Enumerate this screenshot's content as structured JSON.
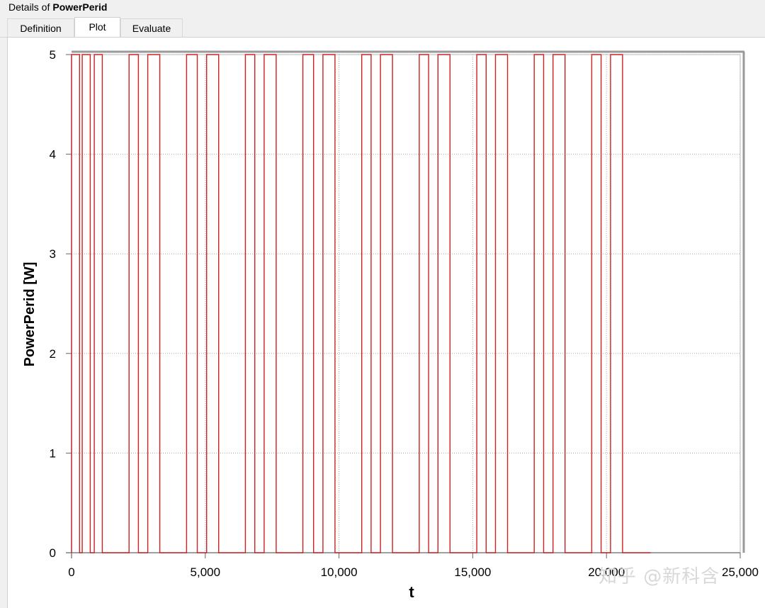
{
  "window": {
    "title_prefix": "Details of",
    "title_name": "PowerPerid"
  },
  "tabs": [
    {
      "label": "Definition",
      "active": false
    },
    {
      "label": "Plot",
      "active": true
    },
    {
      "label": "Evaluate",
      "active": false
    }
  ],
  "watermark": "知乎 @新科含",
  "colors": {
    "series": "#cc2222",
    "axis": "#555555",
    "grid": "#a8a8a8"
  },
  "chart_data": {
    "type": "line",
    "title": "",
    "xlabel": "t",
    "ylabel": "PowerPerid [W]",
    "xlim": [
      0,
      25000
    ],
    "ylim": [
      0,
      5
    ],
    "x_ticks": [
      0,
      5000,
      10000,
      15000,
      20000,
      25000
    ],
    "x_tick_labels": [
      "0",
      "5,000",
      "10,000",
      "15,000",
      "20,000",
      "25,000"
    ],
    "y_ticks": [
      0,
      1,
      2,
      3,
      4,
      5
    ],
    "y_tick_labels": [
      "0",
      "1",
      "2",
      "3",
      "4",
      "5"
    ],
    "grid": true,
    "series": [
      {
        "values_description": "step signal",
        "x": [
          0,
          0,
          300,
          300,
          400,
          400,
          700,
          700,
          850,
          850,
          1150,
          1150,
          2150,
          2150,
          2500,
          2500,
          2850,
          2850,
          3300,
          3300,
          4300,
          4300,
          4700,
          4700,
          5050,
          5050,
          5500,
          5500,
          6500,
          6500,
          6850,
          6850,
          7200,
          7200,
          7650,
          7650,
          8650,
          8650,
          9050,
          9050,
          9400,
          9400,
          9850,
          9850,
          10850,
          10850,
          11200,
          11200,
          11550,
          11550,
          12000,
          12000,
          13000,
          13000,
          13350,
          13350,
          13700,
          13700,
          14150,
          14150,
          15150,
          15150,
          15500,
          15500,
          15850,
          15850,
          16300,
          16300,
          17300,
          17300,
          17650,
          17650,
          18000,
          18000,
          18450,
          18450,
          19450,
          19450,
          19800,
          19800,
          20150,
          20150,
          20600,
          20600,
          21650
        ],
        "y": [
          0,
          5,
          5,
          0,
          0,
          5,
          5,
          0,
          0,
          5,
          5,
          0,
          0,
          5,
          5,
          0,
          0,
          5,
          5,
          0,
          0,
          5,
          5,
          0,
          0,
          5,
          5,
          0,
          0,
          5,
          5,
          0,
          0,
          5,
          5,
          0,
          0,
          5,
          5,
          0,
          0,
          5,
          5,
          0,
          0,
          5,
          5,
          0,
          0,
          5,
          5,
          0,
          0,
          5,
          5,
          0,
          0,
          5,
          5,
          0,
          0,
          5,
          5,
          0,
          0,
          5,
          5,
          0,
          0,
          5,
          5,
          0,
          0,
          5,
          5,
          0,
          0,
          5,
          5,
          0,
          0,
          5,
          5,
          0,
          0
        ]
      }
    ]
  }
}
